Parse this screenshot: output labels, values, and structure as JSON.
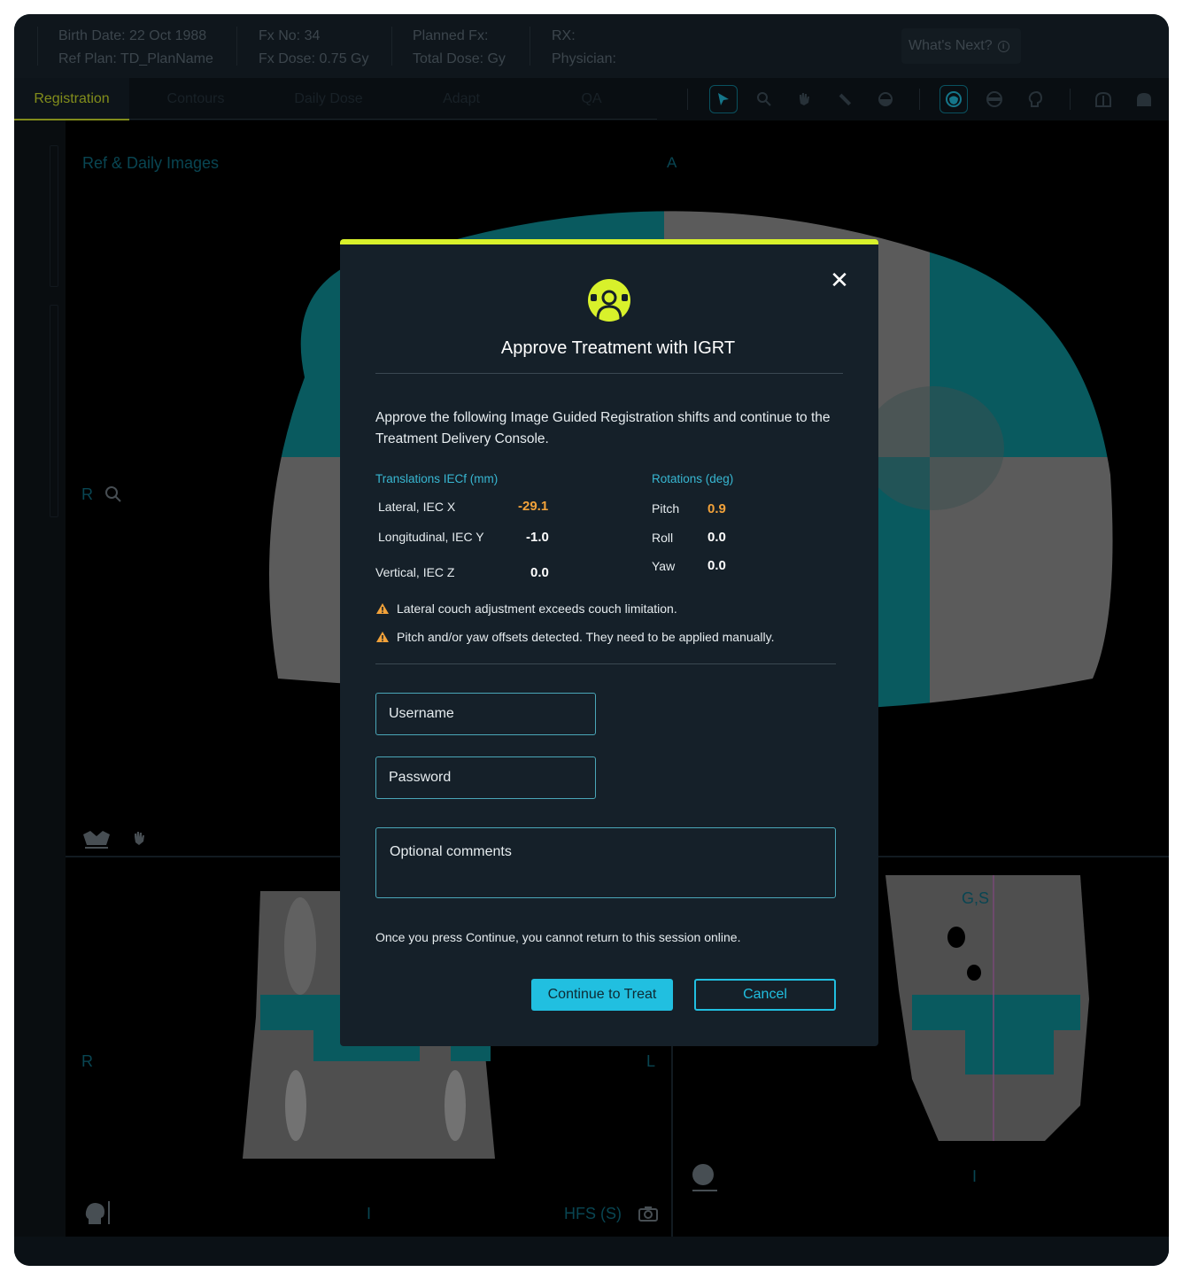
{
  "header": {
    "birth_date": "Birth Date: 22 Oct 1988",
    "ref_plan": "Ref Plan: TD_PlanName",
    "fx_no": "Fx No: 34",
    "fx_dose": "Fx Dose: 0.75 Gy",
    "planned_fx": "Planned Fx:",
    "total_dose": "Total Dose: Gy",
    "rx": "RX:",
    "physician": "Physician:",
    "whats_next": "What's Next?"
  },
  "tabs": [
    {
      "label": "Registration",
      "active": true
    },
    {
      "label": "Contours",
      "active": false
    },
    {
      "label": "Daily Dose",
      "active": false
    },
    {
      "label": "Adapt",
      "active": false
    },
    {
      "label": "QA",
      "active": false
    }
  ],
  "viewport": {
    "title": "Ref & Daily Images",
    "label_a": "A",
    "label_r_main": "R",
    "label_r_bottom": "R",
    "label_l_bottom": "L",
    "label_i_bottom": "I",
    "label_i_right": "I",
    "label_gs": "G,S",
    "orientation": "HFS (S)"
  },
  "modal": {
    "title": "Approve Treatment with IGRT",
    "description": "Approve the following Image Guided Registration shifts and continue to the Treatment Delivery Console.",
    "translations_header": "Translations IECf (mm)",
    "rotations_header": "Rotations (deg)",
    "translations": [
      {
        "label": "Lateral, IEC X",
        "value": "-29.1",
        "warning": true
      },
      {
        "label": "Longitudinal, IEC Y",
        "value": "-1.0",
        "warning": false
      },
      {
        "label": "Vertical, IEC Z",
        "value": "0.0",
        "warning": false
      }
    ],
    "rotations": [
      {
        "label": "Pitch",
        "value": "0.9",
        "warning": true
      },
      {
        "label": "Roll",
        "value": "0.0",
        "warning": false
      },
      {
        "label": "Yaw",
        "value": "0.0",
        "warning": false
      }
    ],
    "warnings": [
      "Lateral couch adjustment exceeds couch limitation.",
      "Pitch and/or yaw offsets detected. They need to be applied manually."
    ],
    "username_placeholder": "Username",
    "password_placeholder": "Password",
    "comments_placeholder": "Optional comments",
    "note": "Once you press Continue, you cannot return to this session online.",
    "continue_label": "Continue to Treat",
    "cancel_label": "Cancel"
  },
  "colors": {
    "accent": "#21bfe0",
    "highlight": "#d8f12b",
    "warning": "#f2a23a",
    "active_tab": "#c6d82a"
  }
}
